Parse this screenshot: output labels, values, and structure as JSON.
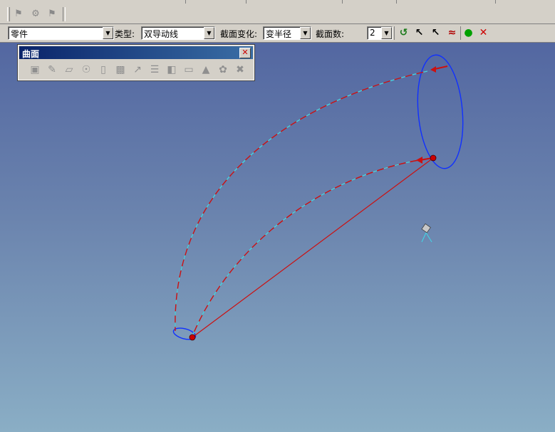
{
  "toolbar_main": {
    "disabled_buttons": [
      "tool-icon-1",
      "tool-icon-2",
      "tool-icon-3"
    ]
  },
  "sweep_bar": {
    "object_combo": {
      "value": "零件"
    },
    "type_label": "类型:",
    "type_combo": {
      "value": "双导动线"
    },
    "section_change_label": "截面变化:",
    "section_change_combo": {
      "value": "变半径"
    },
    "section_count_label": "截面数:",
    "section_count_combo": {
      "value": "2"
    },
    "icons": [
      "sweep-apply-icon",
      "pick-guide-icon",
      "pick-guide2-icon",
      "preview-icon",
      "ok-icon",
      "cancel-icon"
    ],
    "colors": {
      "ok": "#00a000",
      "cancel": "#cc0000"
    }
  },
  "surface_panel": {
    "title": "曲面",
    "icons": [
      "surface-1-icon",
      "surface-2-icon",
      "surface-3-icon",
      "surface-4-icon",
      "surface-5-icon",
      "surface-6-icon",
      "surface-7-icon",
      "surface-8-icon",
      "surface-9-icon",
      "surface-10-icon",
      "surface-11-icon",
      "surface-12-icon",
      "surface-13-icon"
    ]
  },
  "viewport": {
    "background_top": "#5367a1",
    "background_bottom": "#8aaec5",
    "colors": {
      "section": "#1030ff",
      "guide": "#cc1010",
      "dash": "#40d8e8",
      "point": "#cc0000"
    }
  }
}
